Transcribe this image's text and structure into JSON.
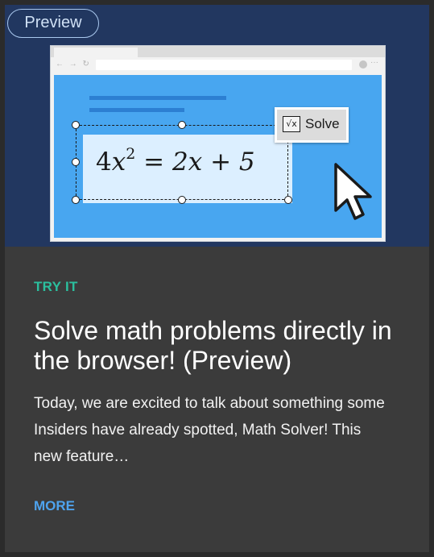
{
  "badge": {
    "label": "Preview"
  },
  "illustration": {
    "equation": {
      "lhs_coefficient": "4",
      "lhs_variable": "x",
      "lhs_exponent": "2",
      "equals": "=",
      "rhs": "2x + 5"
    },
    "solve_button": {
      "icon_text": "√x",
      "label": "Solve"
    },
    "browser_nav_glyphs": "← → ↻",
    "browser_more_glyph": "···"
  },
  "article": {
    "eyebrow": "TRY IT",
    "title": "Solve math problems directly in the browser! (Preview)",
    "summary": "Today, we are excited to talk about something some Insiders have already spotted, Math Solver! This new feature…",
    "more_label": "MORE"
  },
  "colors": {
    "hero_background": "#223760",
    "card_background": "#3b3b3b",
    "eyebrow": "#2bbf9e",
    "link": "#4ea3ee",
    "webpage": "#48a6f0"
  }
}
